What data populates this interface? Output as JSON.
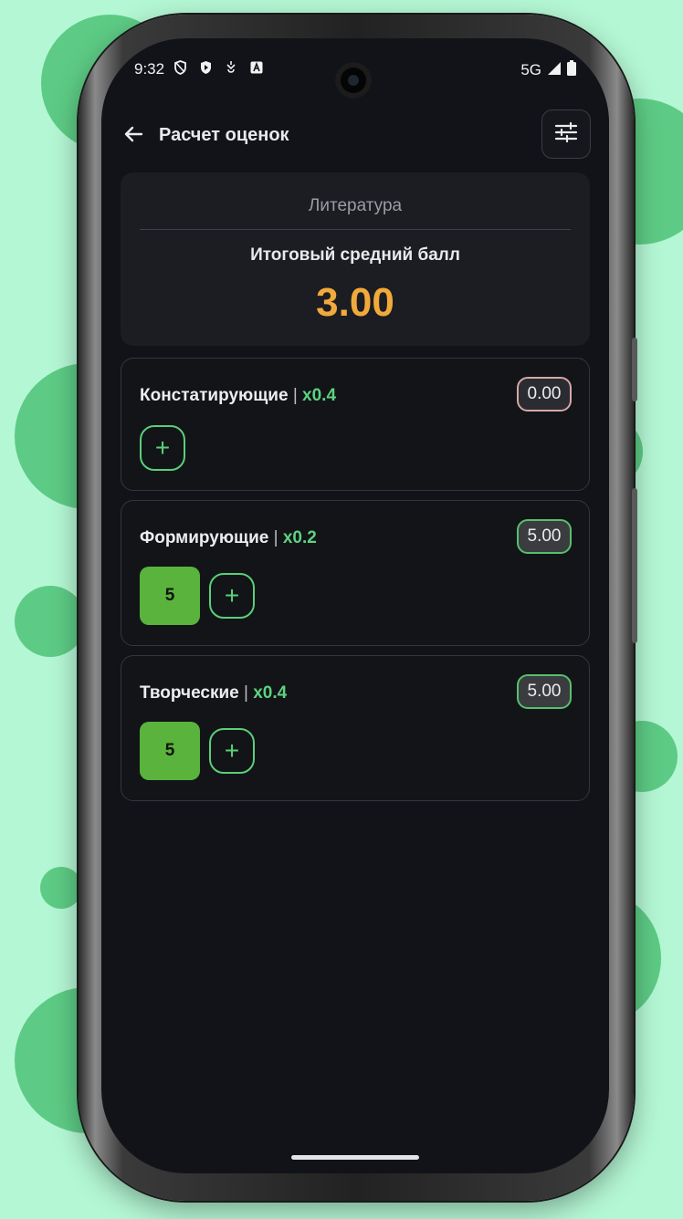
{
  "status_bar": {
    "time": "9:32",
    "left_icons": [
      "shield-outline-icon",
      "shield-play-icon",
      "activity-icon",
      "a-box-icon"
    ],
    "network": "5G",
    "right_icons": [
      "signal-icon",
      "battery-icon"
    ]
  },
  "app_bar": {
    "title": "Расчет оценок",
    "back_icon": "arrow-left-icon",
    "settings_icon": "tune-icon"
  },
  "summary": {
    "subject": "Литература",
    "average_label": "Итоговый средний балл",
    "average_value": "3.00"
  },
  "categories": [
    {
      "name": "Констатирующие",
      "separator": "|",
      "weight": "x0.4",
      "average": "0.00",
      "grades": []
    },
    {
      "name": "Формирующие",
      "separator": "|",
      "weight": "x0.2",
      "average": "5.00",
      "grades": [
        "5"
      ]
    },
    {
      "name": "Творческие",
      "separator": "|",
      "weight": "x0.4",
      "average": "5.00",
      "grades": [
        "5"
      ]
    }
  ],
  "add_button_label": "+",
  "colors": {
    "background": "#b4f7d4",
    "screen": "#111318",
    "accent_green": "#5ed27f",
    "grade_green": "#5ab33c",
    "average_orange": "#f2a93b"
  }
}
